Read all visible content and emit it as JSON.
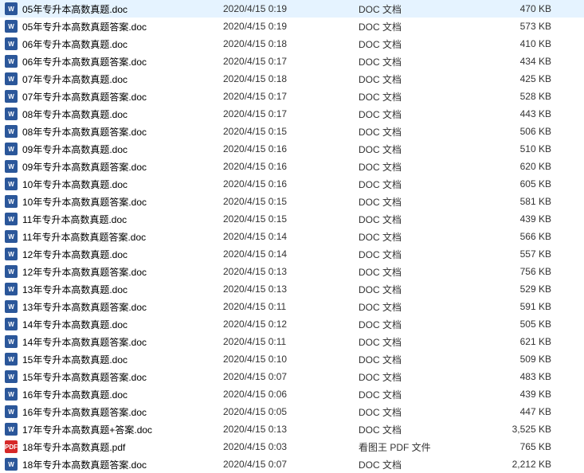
{
  "files": [
    {
      "name": "05年专升本高数真题.doc",
      "date": "2020/4/15 0:19",
      "type": "DOC 文档",
      "size": "470 KB",
      "icon": "doc"
    },
    {
      "name": "05年专升本高数真题答案.doc",
      "date": "2020/4/15 0:19",
      "type": "DOC 文档",
      "size": "573 KB",
      "icon": "doc"
    },
    {
      "name": "06年专升本高数真题.doc",
      "date": "2020/4/15 0:18",
      "type": "DOC 文档",
      "size": "410 KB",
      "icon": "doc"
    },
    {
      "name": "06年专升本高数真题答案.doc",
      "date": "2020/4/15 0:17",
      "type": "DOC 文档",
      "size": "434 KB",
      "icon": "doc"
    },
    {
      "name": "07年专升本高数真题.doc",
      "date": "2020/4/15 0:18",
      "type": "DOC 文档",
      "size": "425 KB",
      "icon": "doc"
    },
    {
      "name": "07年专升本高数真题答案.doc",
      "date": "2020/4/15 0:17",
      "type": "DOC 文档",
      "size": "528 KB",
      "icon": "doc"
    },
    {
      "name": "08年专升本高数真题.doc",
      "date": "2020/4/15 0:17",
      "type": "DOC 文档",
      "size": "443 KB",
      "icon": "doc"
    },
    {
      "name": "08年专升本高数真题答案.doc",
      "date": "2020/4/15 0:15",
      "type": "DOC 文档",
      "size": "506 KB",
      "icon": "doc"
    },
    {
      "name": "09年专升本高数真题.doc",
      "date": "2020/4/15 0:16",
      "type": "DOC 文档",
      "size": "510 KB",
      "icon": "doc"
    },
    {
      "name": "09年专升本高数真题答案.doc",
      "date": "2020/4/15 0:16",
      "type": "DOC 文档",
      "size": "620 KB",
      "icon": "doc"
    },
    {
      "name": "10年专升本高数真题.doc",
      "date": "2020/4/15 0:16",
      "type": "DOC 文档",
      "size": "605 KB",
      "icon": "doc"
    },
    {
      "name": "10年专升本高数真题答案.doc",
      "date": "2020/4/15 0:15",
      "type": "DOC 文档",
      "size": "581 KB",
      "icon": "doc"
    },
    {
      "name": "11年专升本高数真题.doc",
      "date": "2020/4/15 0:15",
      "type": "DOC 文档",
      "size": "439 KB",
      "icon": "doc"
    },
    {
      "name": "11年专升本高数真题答案.doc",
      "date": "2020/4/15 0:14",
      "type": "DOC 文档",
      "size": "566 KB",
      "icon": "doc"
    },
    {
      "name": "12年专升本高数真题.doc",
      "date": "2020/4/15 0:14",
      "type": "DOC 文档",
      "size": "557 KB",
      "icon": "doc"
    },
    {
      "name": "12年专升本高数真题答案.doc",
      "date": "2020/4/15 0:13",
      "type": "DOC 文档",
      "size": "756 KB",
      "icon": "doc"
    },
    {
      "name": "13年专升本高数真题.doc",
      "date": "2020/4/15 0:13",
      "type": "DOC 文档",
      "size": "529 KB",
      "icon": "doc"
    },
    {
      "name": "13年专升本高数真题答案.doc",
      "date": "2020/4/15 0:11",
      "type": "DOC 文档",
      "size": "591 KB",
      "icon": "doc"
    },
    {
      "name": "14年专升本高数真题.doc",
      "date": "2020/4/15 0:12",
      "type": "DOC 文档",
      "size": "505 KB",
      "icon": "doc"
    },
    {
      "name": "14年专升本高数真题答案.doc",
      "date": "2020/4/15 0:11",
      "type": "DOC 文档",
      "size": "621 KB",
      "icon": "doc"
    },
    {
      "name": "15年专升本高数真题.doc",
      "date": "2020/4/15 0:10",
      "type": "DOC 文档",
      "size": "509 KB",
      "icon": "doc"
    },
    {
      "name": "15年专升本高数真题答案.doc",
      "date": "2020/4/15 0:07",
      "type": "DOC 文档",
      "size": "483 KB",
      "icon": "doc"
    },
    {
      "name": "16年专升本高数真题.doc",
      "date": "2020/4/15 0:06",
      "type": "DOC 文档",
      "size": "439 KB",
      "icon": "doc"
    },
    {
      "name": "16年专升本高数真题答案.doc",
      "date": "2020/4/15 0:05",
      "type": "DOC 文档",
      "size": "447 KB",
      "icon": "doc"
    },
    {
      "name": "17年专升本高数真题+答案.doc",
      "date": "2020/4/15 0:13",
      "type": "DOC 文档",
      "size": "3,525 KB",
      "icon": "doc"
    },
    {
      "name": "18年专升本高数真题.pdf",
      "date": "2020/4/15 0:03",
      "type": "看图王 PDF 文件",
      "size": "765 KB",
      "icon": "pdf"
    },
    {
      "name": "18年专升本高数真题答案.doc",
      "date": "2020/4/15 0:07",
      "type": "DOC 文档",
      "size": "2,212 KB",
      "icon": "doc"
    }
  ],
  "iconText": {
    "doc": "W",
    "pdf": "PDF"
  }
}
